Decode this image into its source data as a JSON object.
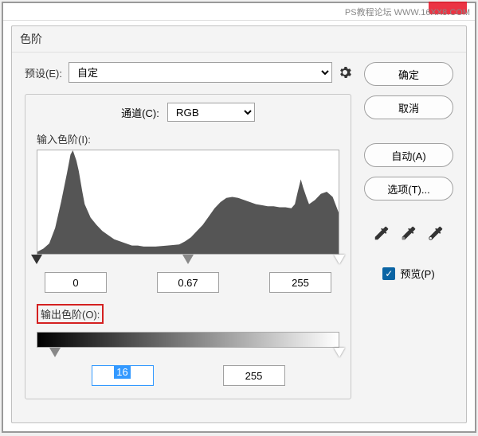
{
  "watermark": "PS教程论坛   WWW.16XX8.COM",
  "dialog": {
    "title": "色阶",
    "preset_label": "预设(E):",
    "preset_value": "自定",
    "channel_label": "通道(C):",
    "channel_value": "RGB",
    "input_label": "输入色阶(I):",
    "output_label": "输出色阶(O):"
  },
  "input_levels": {
    "black": "0",
    "gamma": "0.67",
    "white": "255"
  },
  "output_levels": {
    "low": "16",
    "high": "255"
  },
  "buttons": {
    "ok": "确定",
    "cancel": "取消",
    "auto": "自动(A)",
    "options": "选项(T)..."
  },
  "preview": {
    "label": "预览(P)",
    "checked": true
  },
  "chart_data": {
    "type": "area",
    "title": "",
    "xlabel": "",
    "ylabel": "",
    "xlim": [
      0,
      255
    ],
    "ylim": [
      0,
      100
    ],
    "x": [
      0,
      5,
      10,
      15,
      20,
      25,
      28,
      30,
      33,
      35,
      38,
      40,
      45,
      50,
      55,
      60,
      65,
      70,
      75,
      80,
      85,
      90,
      95,
      100,
      110,
      120,
      125,
      130,
      135,
      140,
      145,
      150,
      155,
      160,
      165,
      170,
      175,
      180,
      185,
      190,
      195,
      200,
      205,
      210,
      215,
      218,
      220,
      223,
      225,
      228,
      230,
      235,
      240,
      245,
      250,
      255
    ],
    "values": [
      2,
      5,
      10,
      25,
      50,
      78,
      96,
      100,
      90,
      80,
      60,
      48,
      35,
      28,
      22,
      18,
      14,
      12,
      10,
      8,
      8,
      7,
      7,
      7,
      8,
      9,
      12,
      16,
      22,
      28,
      36,
      44,
      50,
      54,
      55,
      54,
      52,
      50,
      48,
      47,
      46,
      46,
      45,
      45,
      44,
      48,
      58,
      72,
      64,
      54,
      48,
      52,
      58,
      60,
      55,
      40
    ]
  }
}
